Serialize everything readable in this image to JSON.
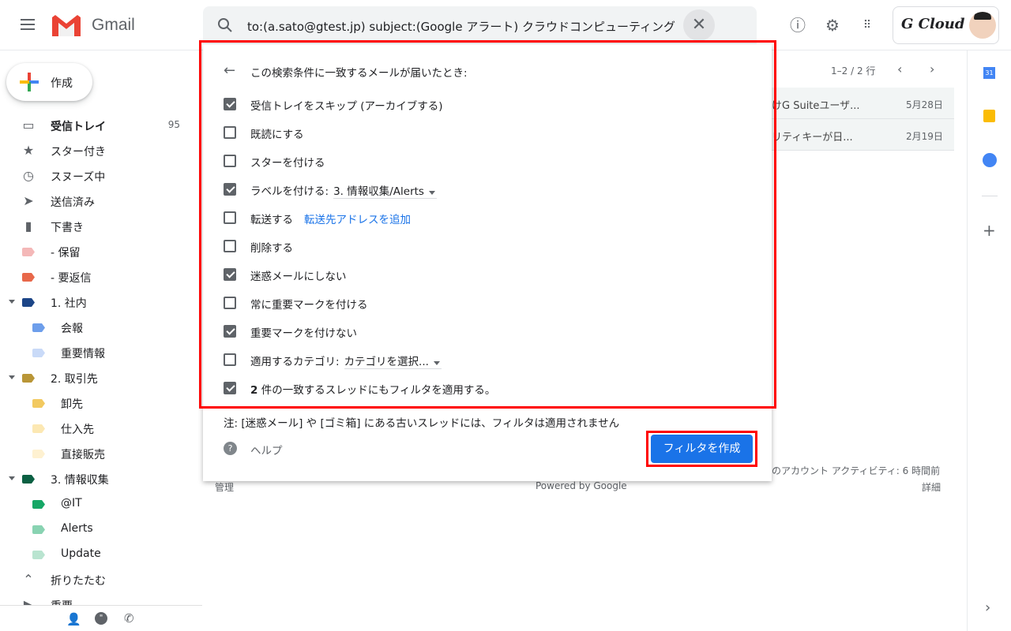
{
  "header": {
    "app_name": "Gmail",
    "search_query": "to:(a.sato@gtest.jp) subject:(Google アラート) クラウドコンピューティング",
    "brand": "G Cloud"
  },
  "sidebar": {
    "compose": "作成",
    "items": [
      {
        "label": "受信トレイ",
        "count": "95",
        "icon": "inbox-icon",
        "bold": true
      },
      {
        "label": "スター付き",
        "icon": "star-icon"
      },
      {
        "label": "スヌーズ中",
        "icon": "clock-icon"
      },
      {
        "label": "送信済み",
        "icon": "send-icon"
      },
      {
        "label": "下書き",
        "icon": "draft-icon"
      },
      {
        "label": "- 保留",
        "color": "#f4b8b8",
        "indent": 0
      },
      {
        "label": "- 要返信",
        "color": "#e8684a",
        "indent": 0
      },
      {
        "label": "1. 社内",
        "color": "#1c4587",
        "indent": 0,
        "caret": true
      },
      {
        "label": "会報",
        "color": "#6d9eeb",
        "indent": 1
      },
      {
        "label": "重要情報",
        "color": "#c9daf8",
        "indent": 1
      },
      {
        "label": "2. 取引先",
        "color": "#b99637",
        "indent": 0,
        "caret": true
      },
      {
        "label": "卸先",
        "color": "#f2c960",
        "indent": 1
      },
      {
        "label": "仕入先",
        "color": "#fce8b3",
        "indent": 1
      },
      {
        "label": "直接販売",
        "color": "#fef1d1",
        "indent": 1
      },
      {
        "label": "3. 情報収集",
        "color": "#0b6043",
        "indent": 0,
        "caret": true
      },
      {
        "label": "@IT",
        "color": "#16a766",
        "indent": 1
      },
      {
        "label": "Alerts",
        "color": "#89d3b2",
        "indent": 1
      },
      {
        "label": "Update",
        "color": "#b9e4d0",
        "indent": 1
      },
      {
        "label": "折りたたむ",
        "icon": "chevron-up-icon"
      },
      {
        "label": "重要",
        "icon": "important-icon"
      }
    ]
  },
  "filter": {
    "heading": "この検索条件に一致するメールが届いたとき:",
    "options": [
      {
        "label": "受信トレイをスキップ (アーカイブする)",
        "checked": true
      },
      {
        "label": "既読にする",
        "checked": false
      },
      {
        "label": "スターを付ける",
        "checked": false
      },
      {
        "label": "ラベルを付ける:",
        "checked": true,
        "select": "3. 情報収集/Alerts"
      },
      {
        "label": "転送する",
        "checked": false,
        "link": "転送先アドレスを追加"
      },
      {
        "label": "削除する",
        "checked": false
      },
      {
        "label": "迷惑メールにしない",
        "checked": true
      },
      {
        "label": "常に重要マークを付ける",
        "checked": false
      },
      {
        "label": "重要マークを付けない",
        "checked": true
      },
      {
        "label": "適用するカテゴリ:",
        "checked": false,
        "select": "カテゴリを選択..."
      },
      {
        "label_bold": "2",
        "label": " 件の一致するスレッドにもフィルタを適用する。",
        "checked": true
      }
    ],
    "note": "注: [迷惑メール] や [ゴミ箱] にある古いスレッドには、フィルタは適用されません",
    "help": "ヘルプ",
    "create_button": "フィルタを作成"
  },
  "mail": {
    "range": "1–2 / 2 行",
    "rows": [
      {
        "subject": "けG Suiteユーザ...",
        "date": "5月28日"
      },
      {
        "subject": "リティキーが日...",
        "date": "2月19日"
      }
    ],
    "footer_activity": "のアカウント アクティビティ: 6 時間前",
    "footer_details": "詳細",
    "footer_manage": "管理",
    "footer_powered": "Powered by Google"
  },
  "colors": {
    "accent": "#1a73e8",
    "highlight": "#ff0000"
  }
}
